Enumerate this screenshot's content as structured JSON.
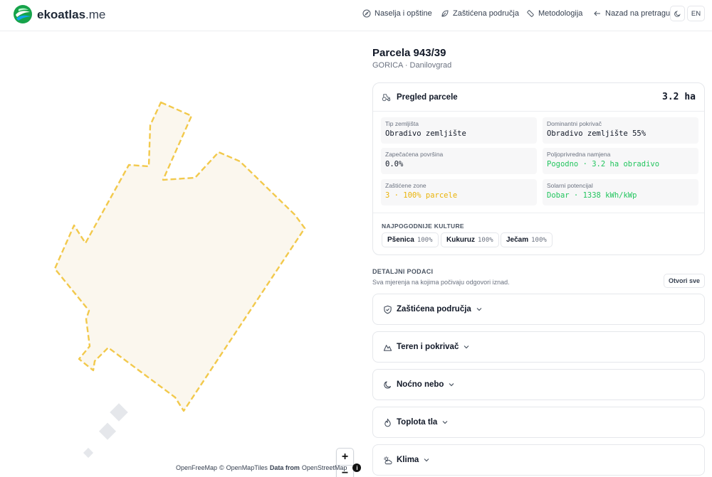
{
  "header": {
    "brand_name": "ekoatlas",
    "brand_tld": ".me",
    "nav": [
      {
        "label": "Naselja i opštine",
        "icon": "compass-icon"
      },
      {
        "label": "Zaštićena područja",
        "icon": "leaf-icon"
      },
      {
        "label": "Metodologija",
        "icon": "ruler-icon"
      },
      {
        "label": "Nazad na pretragu",
        "icon": "arrow-left-icon"
      }
    ],
    "theme_icon": "moon-icon",
    "language": "EN"
  },
  "map": {
    "zoom_in": "+",
    "zoom_out": "−",
    "attribution": {
      "openfreemap": "OpenFreeMap",
      "copyright": "©",
      "openmaptiles": "OpenMapTiles",
      "data_from": "Data from",
      "openstreetmap": "OpenStreetMap",
      "info": "i"
    },
    "colors": {
      "parcel_outline": "#f2c94c",
      "parcel_fill": "#fbf7ee",
      "buildings": "#e5e7eb"
    }
  },
  "parcel": {
    "title": "Parcela 943/39",
    "subtitle": "GORICA · Danilovgrad"
  },
  "overview": {
    "title": "Pregled parcele",
    "icon": "tractor-icon",
    "area": "3.2 ha",
    "fields": [
      {
        "label": "Tip zemljišta",
        "value": "Obradivo zemljište",
        "tone": "default"
      },
      {
        "label": "Dominantni pokrivač",
        "value": "Obradivo zemljište 55%",
        "tone": "default"
      },
      {
        "label": "Zapečaćena površina",
        "value": "0.0%",
        "tone": "default"
      },
      {
        "label": "Poljoprivredna namjena",
        "value": "Pogodno · 3.2 ha obradivo",
        "tone": "green"
      },
      {
        "label": "Zaštićene zone",
        "value": "3 · 100% parcele",
        "tone": "amber"
      },
      {
        "label": "Solarni potencijal",
        "value": "Dobar · 1338 kWh/kWp",
        "tone": "green"
      }
    ],
    "crops_label": "NAJPOGODNIJE KULTURE",
    "crops": [
      {
        "name": "Pšenica",
        "pct": "100%"
      },
      {
        "name": "Kukuruz",
        "pct": "100%"
      },
      {
        "name": "Ječam",
        "pct": "100%"
      }
    ],
    "colors": {
      "green": "#22c55e",
      "amber": "#eab308"
    }
  },
  "details": {
    "label": "DETALJNI PODACI",
    "subtitle": "Sva mjerenja na kojima počivaju odgovori iznad.",
    "open_all": "Otvori sve",
    "sections": [
      {
        "title": "Zaštićena područja",
        "icon": "shield-icon"
      },
      {
        "title": "Teren i pokrivač",
        "icon": "mountain-icon"
      },
      {
        "title": "Noćno nebo",
        "icon": "moon-icon"
      },
      {
        "title": "Toplota tla",
        "icon": "flame-icon"
      },
      {
        "title": "Klima",
        "icon": "sun-cloud-icon"
      }
    ]
  }
}
